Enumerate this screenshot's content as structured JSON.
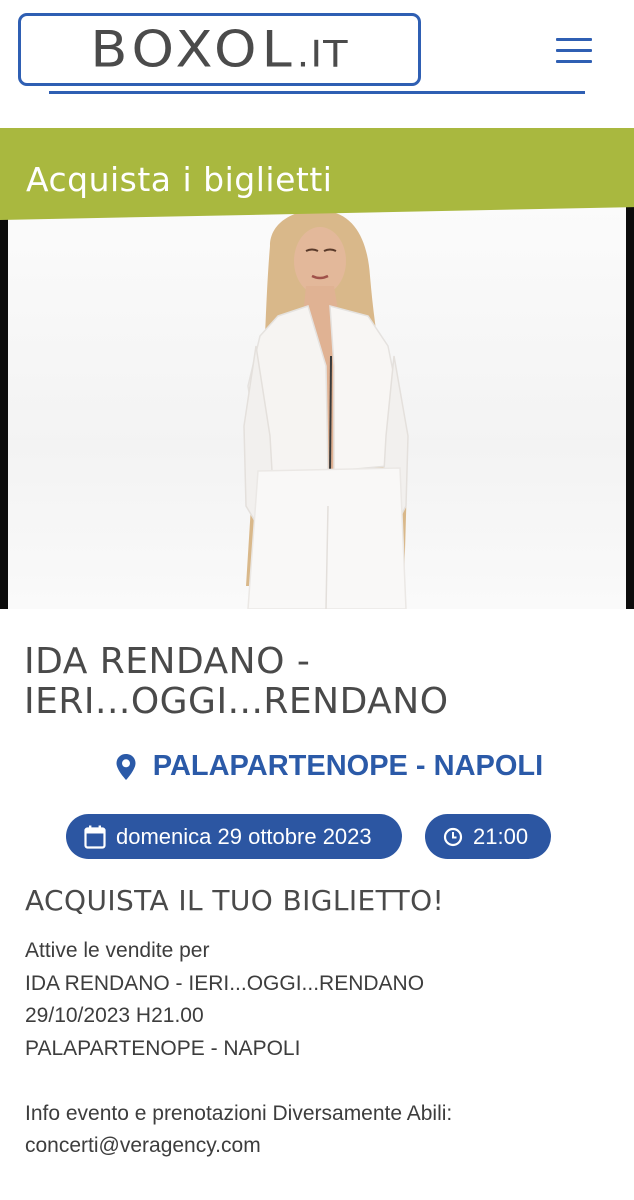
{
  "header": {
    "logo_main": "BOXOL",
    "logo_tld": ".IT",
    "menu_icon": "hamburger-menu-icon",
    "accent_color": "#2f5fb3"
  },
  "banner": {
    "title": "Acquista i biglietti",
    "color": "#a9b83f"
  },
  "event": {
    "image_icon": "event-photo",
    "title": "IDA RENDANO - IERI...OGGI...RENDANO",
    "venue_icon": "map-pin-icon",
    "venue": "PALAPARTENOPE - NAPOLI",
    "date_icon": "calendar-icon",
    "date": "domenica 29 ottobre 2023",
    "time_icon": "clock-icon",
    "time": "21:00"
  },
  "purchase": {
    "heading": "ACQUISTA IL TUO BIGLIETTO!",
    "lines": [
      "Attive le vendite per",
      "IDA RENDANO - IERI...OGGI...RENDANO",
      "29/10/2023 H21.00",
      "PALAPARTENOPE - NAPOLI"
    ],
    "info_lines": [
      "Info evento e prenotazioni Diversamente Abili:",
      "concerti@veragency.com"
    ]
  }
}
